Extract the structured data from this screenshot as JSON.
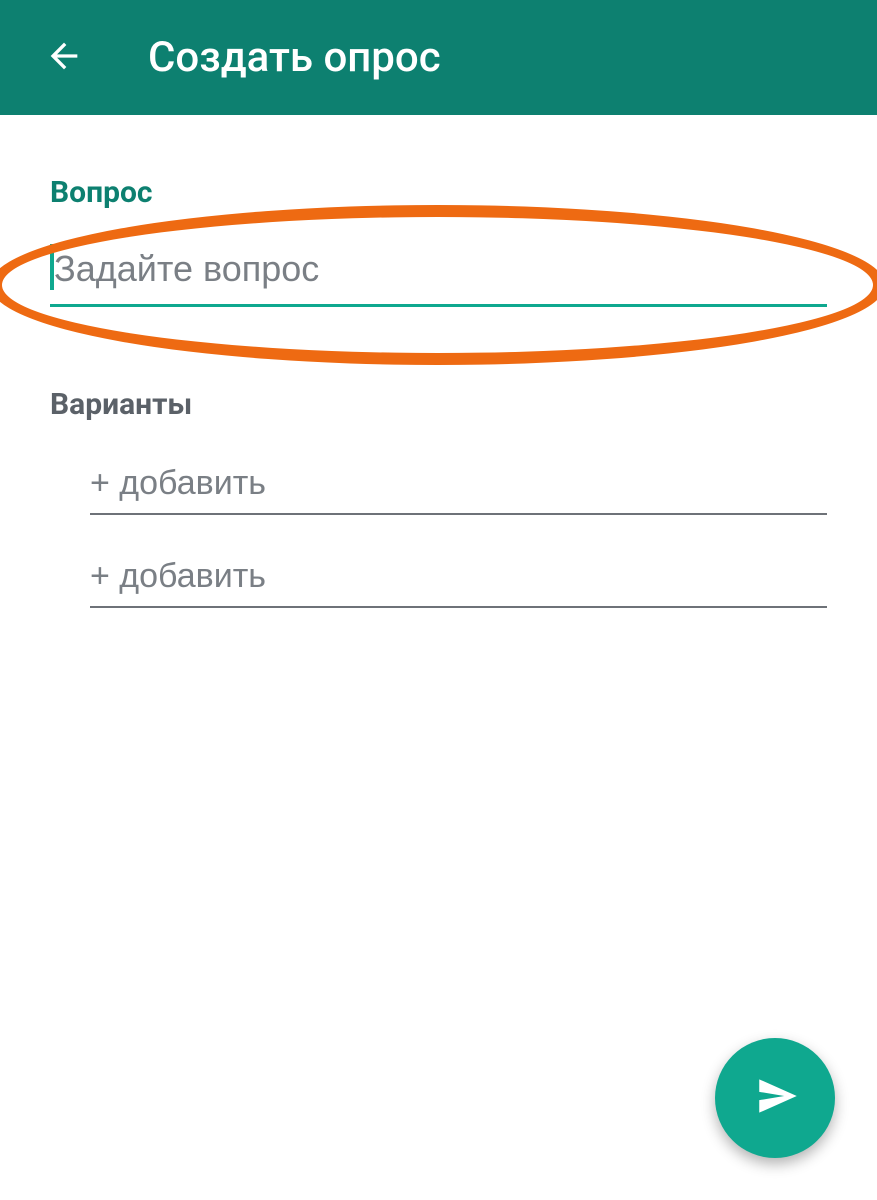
{
  "header": {
    "title": "Создать опрос"
  },
  "question": {
    "label": "Вопрос",
    "placeholder": "Задайте вопрос",
    "value": ""
  },
  "options": {
    "label": "Варианты",
    "items": [
      {
        "placeholder": "+ добавить"
      },
      {
        "placeholder": "+ добавить"
      }
    ]
  },
  "colors": {
    "primary": "#0d8070",
    "accent": "#0fa88f",
    "highlight": "#ee6a12"
  }
}
